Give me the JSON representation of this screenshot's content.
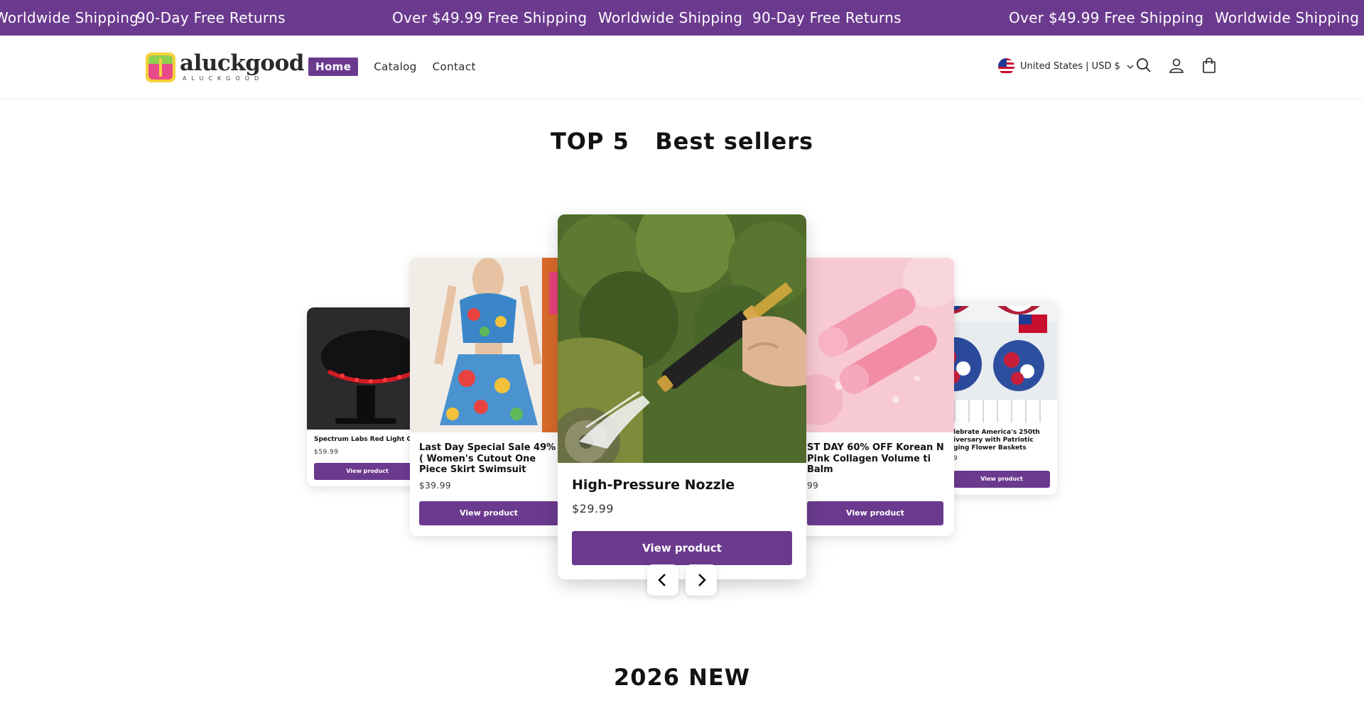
{
  "announcement": {
    "messages": [
      "Worldwide Shipping",
      "90-Day Free Returns",
      "Over $49.99 Free Shipping",
      "Worldwide Shipping",
      "90-Day Free Returns",
      "Over $49.99 Free Shipping",
      "Worldwide Shipping"
    ],
    "background_color": "#6b3a8e"
  },
  "header": {
    "logo_word": "aluckgood",
    "logo_sub": "ALUCKGOOD",
    "nav": [
      {
        "label": "Home",
        "active": true
      },
      {
        "label": "Catalog",
        "active": false
      },
      {
        "label": "Contact",
        "active": false
      }
    ],
    "locale": "United States | USD $",
    "icons": [
      "search-icon",
      "account-icon",
      "cart-icon"
    ]
  },
  "bestsellers": {
    "title": "TOP 5   Best sellers",
    "accent_color": "#6b3a8e",
    "products": [
      {
        "name": "Spectrum Labs Red Light Ca",
        "price": "$59.99",
        "button": "View product"
      },
      {
        "name": "Last Day Special Sale 49% ( Women's Cutout One Piece Skirt Swimsuit",
        "price": "$39.99",
        "button": "View product"
      },
      {
        "name": "High-Pressure Nozzle",
        "price": "$29.99",
        "button": "View product"
      },
      {
        "name": "ST DAY 60% OFF  Korean N Pink Collagen Volume ti Balm",
        "price": "99",
        "button": "View product"
      },
      {
        "name": "lebrate America's 250th iversary with Patriotic ging Flower Baskets",
        "price": "9",
        "button": "View product"
      }
    ],
    "prev_icon": "chevron-left-icon",
    "next_icon": "chevron-right-icon"
  },
  "new_section": {
    "title": "2026 NEW"
  }
}
